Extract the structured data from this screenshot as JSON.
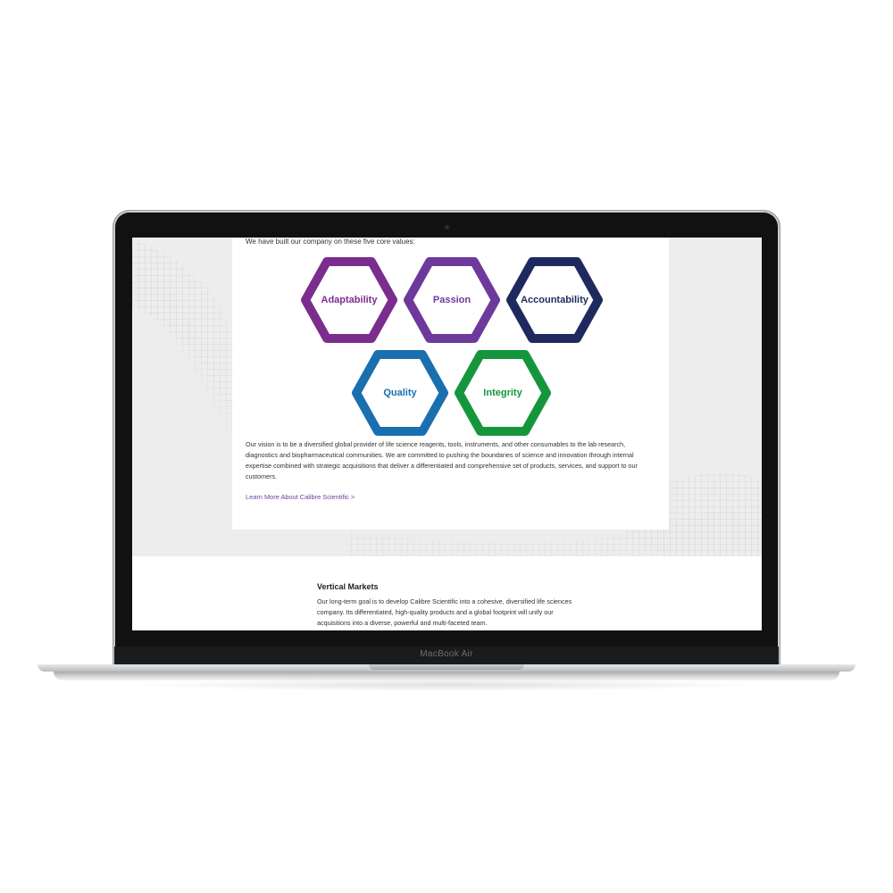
{
  "device": {
    "model_label": "MacBook Air"
  },
  "page": {
    "intro": "We have built our company on these five core values:",
    "values": [
      {
        "label": "Adaptability",
        "color": "#7b2d8e"
      },
      {
        "label": "Passion",
        "color": "#6d3a9c"
      },
      {
        "label": "Accountability",
        "color": "#1e2a5e"
      },
      {
        "label": "Quality",
        "color": "#1a6fae"
      },
      {
        "label": "Integrity",
        "color": "#15963c"
      }
    ],
    "vision": "Our vision is to be a diversified global provider of life science reagents, tools, instruments, and other consumables to the lab research, diagnostics and biopharmaceutical communities. We are committed to pushing the boundaries of science and innovation through internal expertise combined with strategic acquisitions that deliver a differentiated and comprehensive set of products, services, and support to our customers.",
    "learn_more": "Learn More About Calibre Scientific >",
    "vertical_markets": {
      "title": "Vertical Markets",
      "body": "Our long-term goal is to develop Calibre Scientific into a cohesive, diversified life sciences company. Its differentiated, high-quality products and a global footprint will unify our acquisitions into a diverse, powerful and multi-faceted team."
    }
  },
  "colors": {
    "link": "#6b3fa0",
    "section_bg": "#ededed"
  }
}
